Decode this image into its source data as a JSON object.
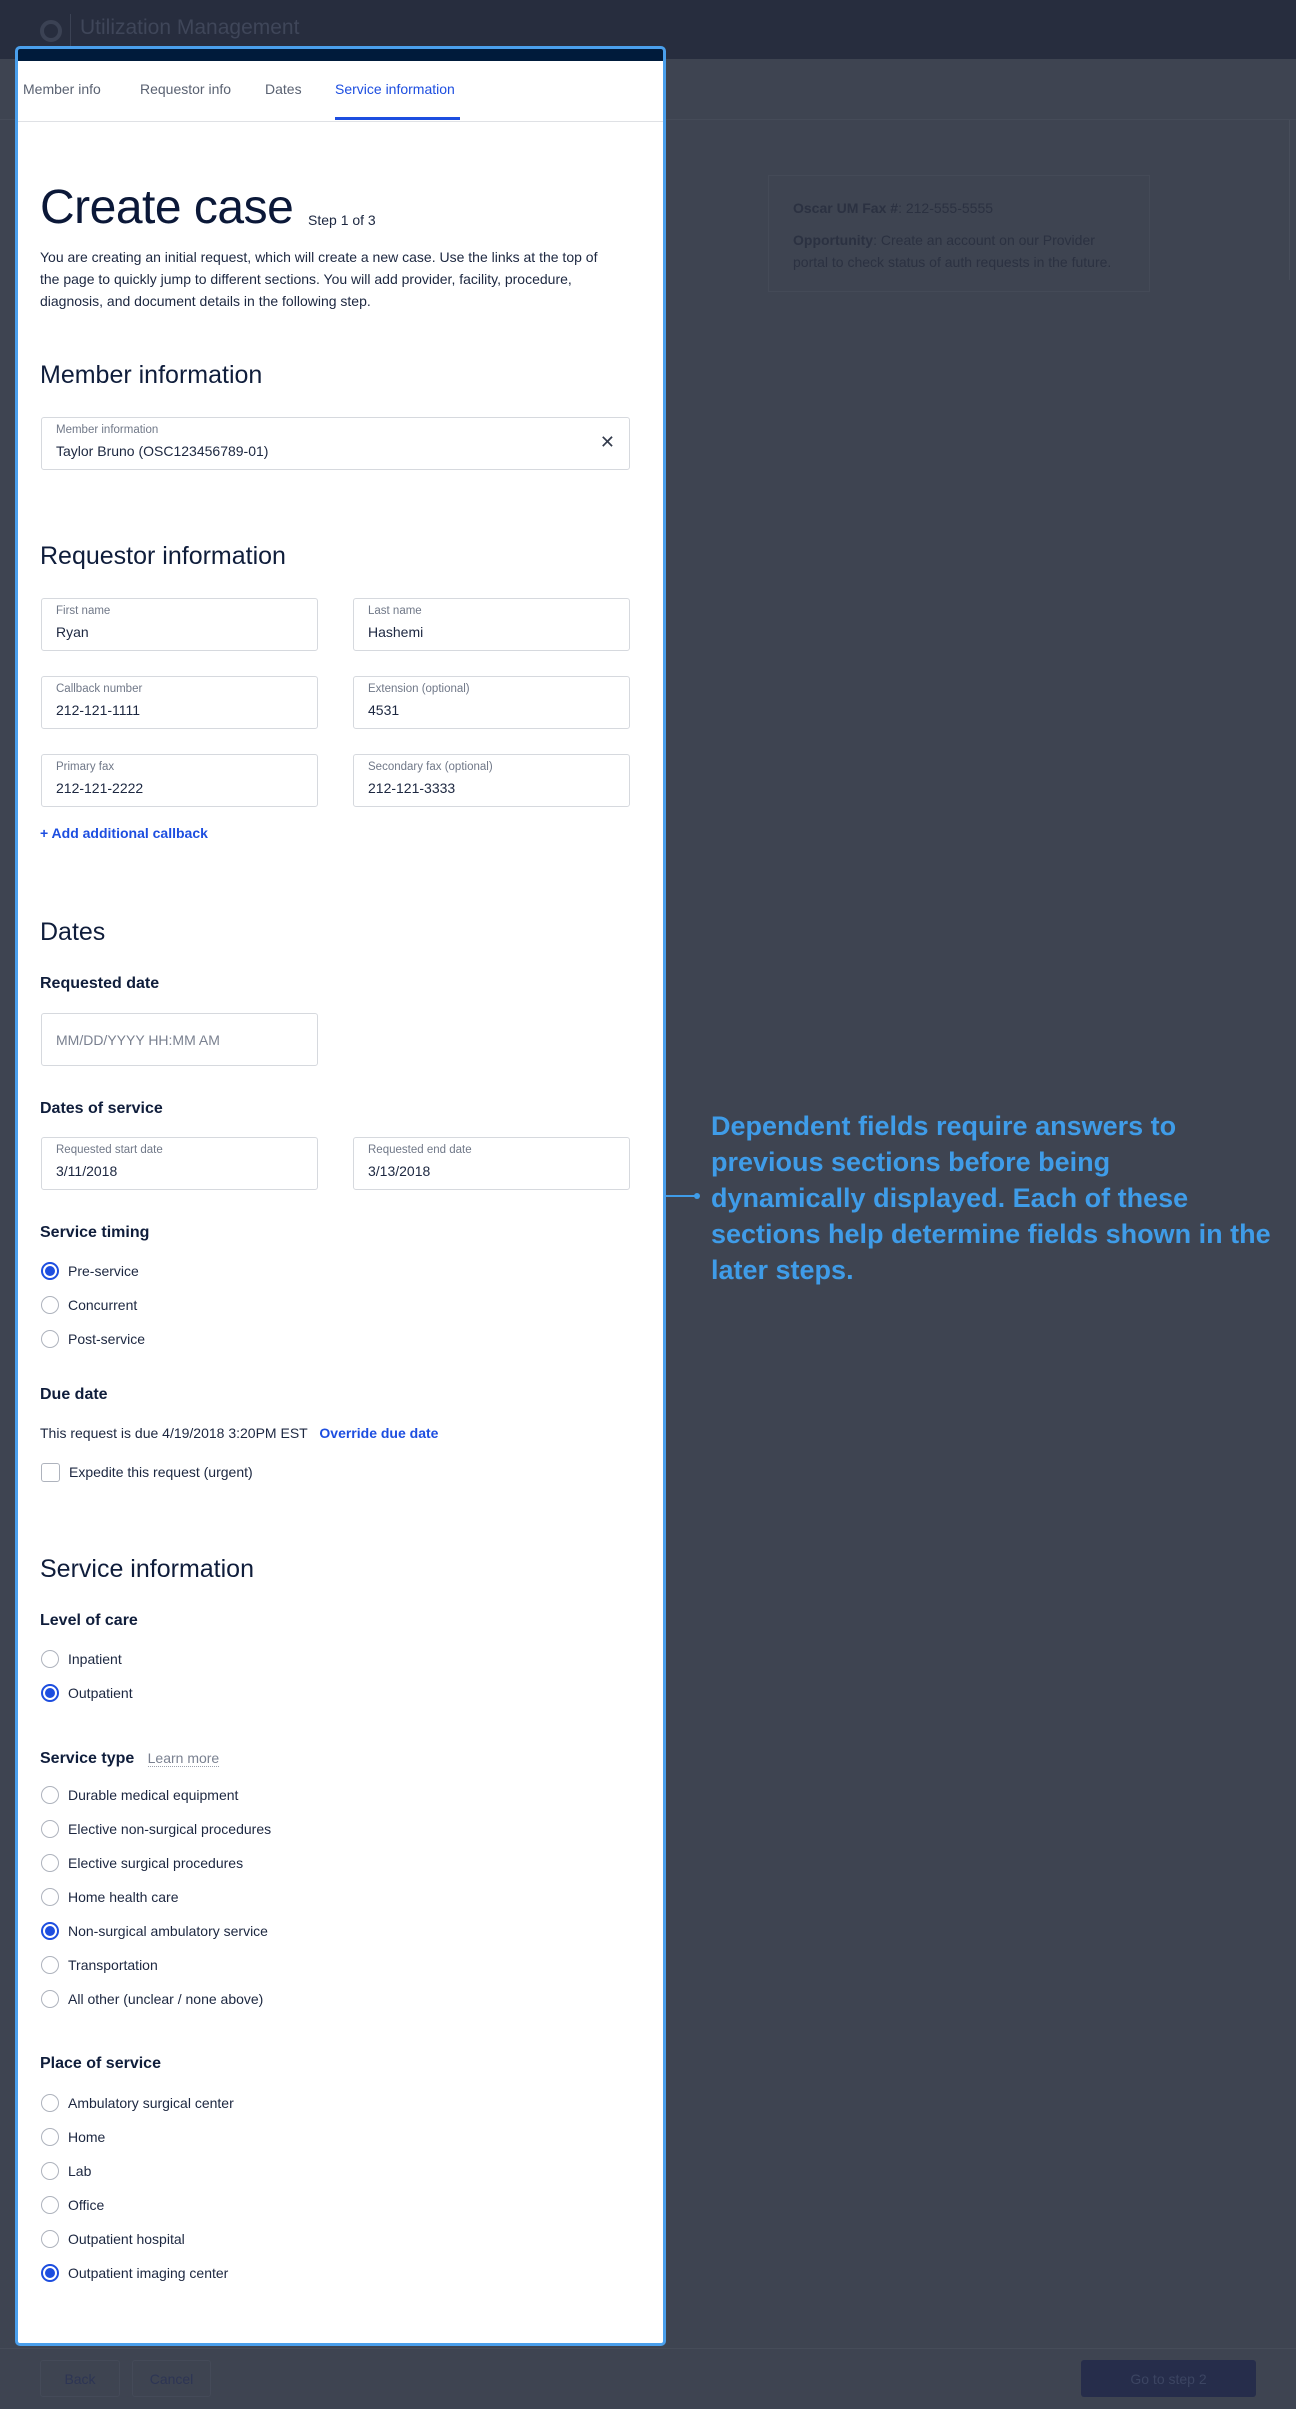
{
  "app": {
    "title": "Utilization Management"
  },
  "info_card": {
    "fax_label": "Oscar UM Fax #",
    "fax_value": ": 212-555-5555",
    "opportunity_label": "Opportunity",
    "opportunity_text": ": Create an account on our Provider portal to check status of auth requests in the future."
  },
  "tabs": [
    {
      "label": "Member info"
    },
    {
      "label": "Requestor info"
    },
    {
      "label": "Dates"
    },
    {
      "label": "Service information",
      "active": true
    }
  ],
  "page": {
    "title": "Create case",
    "step": "Step 1 of 3",
    "description": "You are creating an initial request, which will create a new case. Use the links at the top of the page to quickly jump to different sections. You will add provider, facility, procedure, diagnosis, and document details in the following step."
  },
  "member": {
    "heading": "Member information",
    "field_label": "Member information",
    "field_value": "Taylor Bruno (OSC123456789-01)",
    "clear_icon": "close-icon"
  },
  "requestor": {
    "heading": "Requestor information",
    "fields": [
      {
        "label": "First name",
        "value": "Ryan"
      },
      {
        "label": "Last name",
        "value": "Hashemi"
      },
      {
        "label": "Callback number",
        "value": "212-121-1111"
      },
      {
        "label": "Extension (optional)",
        "value": "4531"
      },
      {
        "label": "Primary fax",
        "value": "212-121-2222"
      },
      {
        "label": "Secondary fax (optional)",
        "value": "212-121-3333"
      }
    ],
    "add_callback": "+  Add additional callback"
  },
  "dates": {
    "heading": "Dates",
    "requested_date_label": "Requested date",
    "requested_date_placeholder": "MM/DD/YYYY HH:MM AM",
    "dates_of_service_label": "Dates of service",
    "start_label": "Requested start date",
    "start_value": "3/11/2018",
    "end_label": "Requested end date",
    "end_value": "3/13/2018",
    "service_timing_label": "Service timing",
    "service_timing_options": [
      "Pre-service",
      "Concurrent",
      "Post-service"
    ],
    "service_timing_selected": "Pre-service",
    "due_date_label": "Due date",
    "due_text": "This request is due 4/19/2018 3:20PM EST",
    "override_link": "Override due date",
    "expedite_label": "Expedite this request (urgent)",
    "expedite_checked": false
  },
  "service": {
    "heading": "Service information",
    "level_of_care_label": "Level of care",
    "level_of_care_options": [
      "Inpatient",
      "Outpatient"
    ],
    "level_of_care_selected": "Outpatient",
    "service_type_label": "Service type",
    "learn_more": "Learn more",
    "service_type_options": [
      "Durable medical equipment",
      "Elective non-surgical procedures",
      "Elective surgical procedures",
      "Home health care",
      "Non-surgical ambulatory service",
      "Transportation",
      "All other (unclear / none above)"
    ],
    "service_type_selected": "Non-surgical ambulatory service",
    "place_of_service_label": "Place of service",
    "place_of_service_options": [
      "Ambulatory surgical center",
      "Home",
      "Lab",
      "Office",
      "Outpatient hospital",
      "Outpatient imaging center"
    ],
    "place_of_service_selected": "Outpatient imaging center"
  },
  "annotation": {
    "text": "Dependent fields require answers to previous sections before being dynamically displayed. Each of these sections help determine fields shown in the later steps.",
    "color": "#3f9ce8"
  },
  "footer": {
    "back": "Back",
    "cancel": "Cancel",
    "next": "Go to step 2"
  },
  "colors": {
    "accent": "#1d4ee0",
    "overlay": "#3e4451",
    "highlight_border": "#4a9fec"
  }
}
